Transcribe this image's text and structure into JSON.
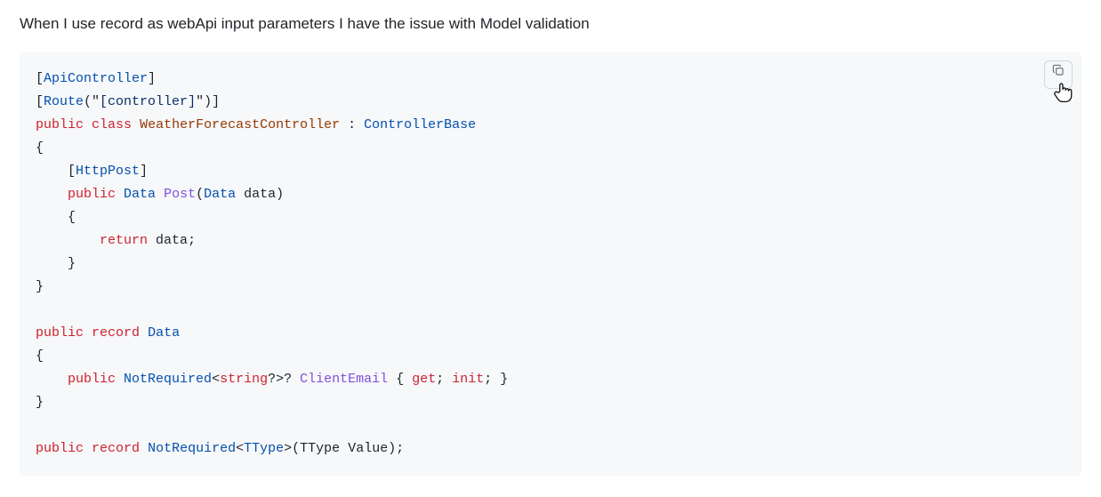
{
  "intro": "When I use record as webApi input parameters I have the issue with Model validation",
  "copy_button_title": "Copy",
  "code": {
    "l1": {
      "pre": "[",
      "attr": "ApiController",
      "post": "]"
    },
    "l2": {
      "pre": "[",
      "attr": "Route",
      "str_open": "(\"",
      "str_body": "[controller]",
      "str_close": "\")",
      "post": "]"
    },
    "l3": {
      "kw_public": "public",
      "sp1": " ",
      "kw_class": "class",
      "sp2": " ",
      "type1": "WeatherForecastController",
      "sep": " : ",
      "type2": "ControllerBase"
    },
    "l4": "{",
    "l5": {
      "indent": "    ",
      "pre": "[",
      "attr": "HttpPost",
      "post": "]"
    },
    "l6": {
      "indent": "    ",
      "kw_public": "public",
      "sp1": " ",
      "type_ret": "Data",
      "sp2": " ",
      "method": "Post",
      "open": "(",
      "type_arg": "Data",
      "sp3": " ",
      "arg": "data",
      "close": ")"
    },
    "l7": "    {",
    "l8": {
      "indent": "        ",
      "kw_return": "return",
      "sp": " ",
      "ident": "data",
      "semi": ";"
    },
    "l9": "    }",
    "l10": "}",
    "blank1": "",
    "l11": {
      "kw_public": "public",
      "sp1": " ",
      "kw_record": "record",
      "sp2": " ",
      "type": "Data"
    },
    "l12": "{",
    "l13": {
      "indent": "    ",
      "kw_public": "public",
      "sp1": " ",
      "type_outer": "NotRequired",
      "lt": "<",
      "type_inner": "string",
      "q1": "?",
      "gt": ">",
      "q2": "?",
      "sp2": " ",
      "prop": "ClientEmail",
      "sp3": " ",
      "open": "{ ",
      "kw_get": "get",
      "semi1": "; ",
      "kw_init": "init",
      "semi2": "; ",
      "close": "}"
    },
    "l14": "}",
    "blank2": "",
    "l15": {
      "kw_public": "public",
      "sp1": " ",
      "kw_record": "record",
      "sp2": " ",
      "type_outer": "NotRequired",
      "lt": "<",
      "type_param": "TType",
      "gt": ">",
      "open": "(",
      "arg_type": "TType",
      "sp3": " ",
      "arg_name": "Value",
      "close": ");"
    }
  }
}
